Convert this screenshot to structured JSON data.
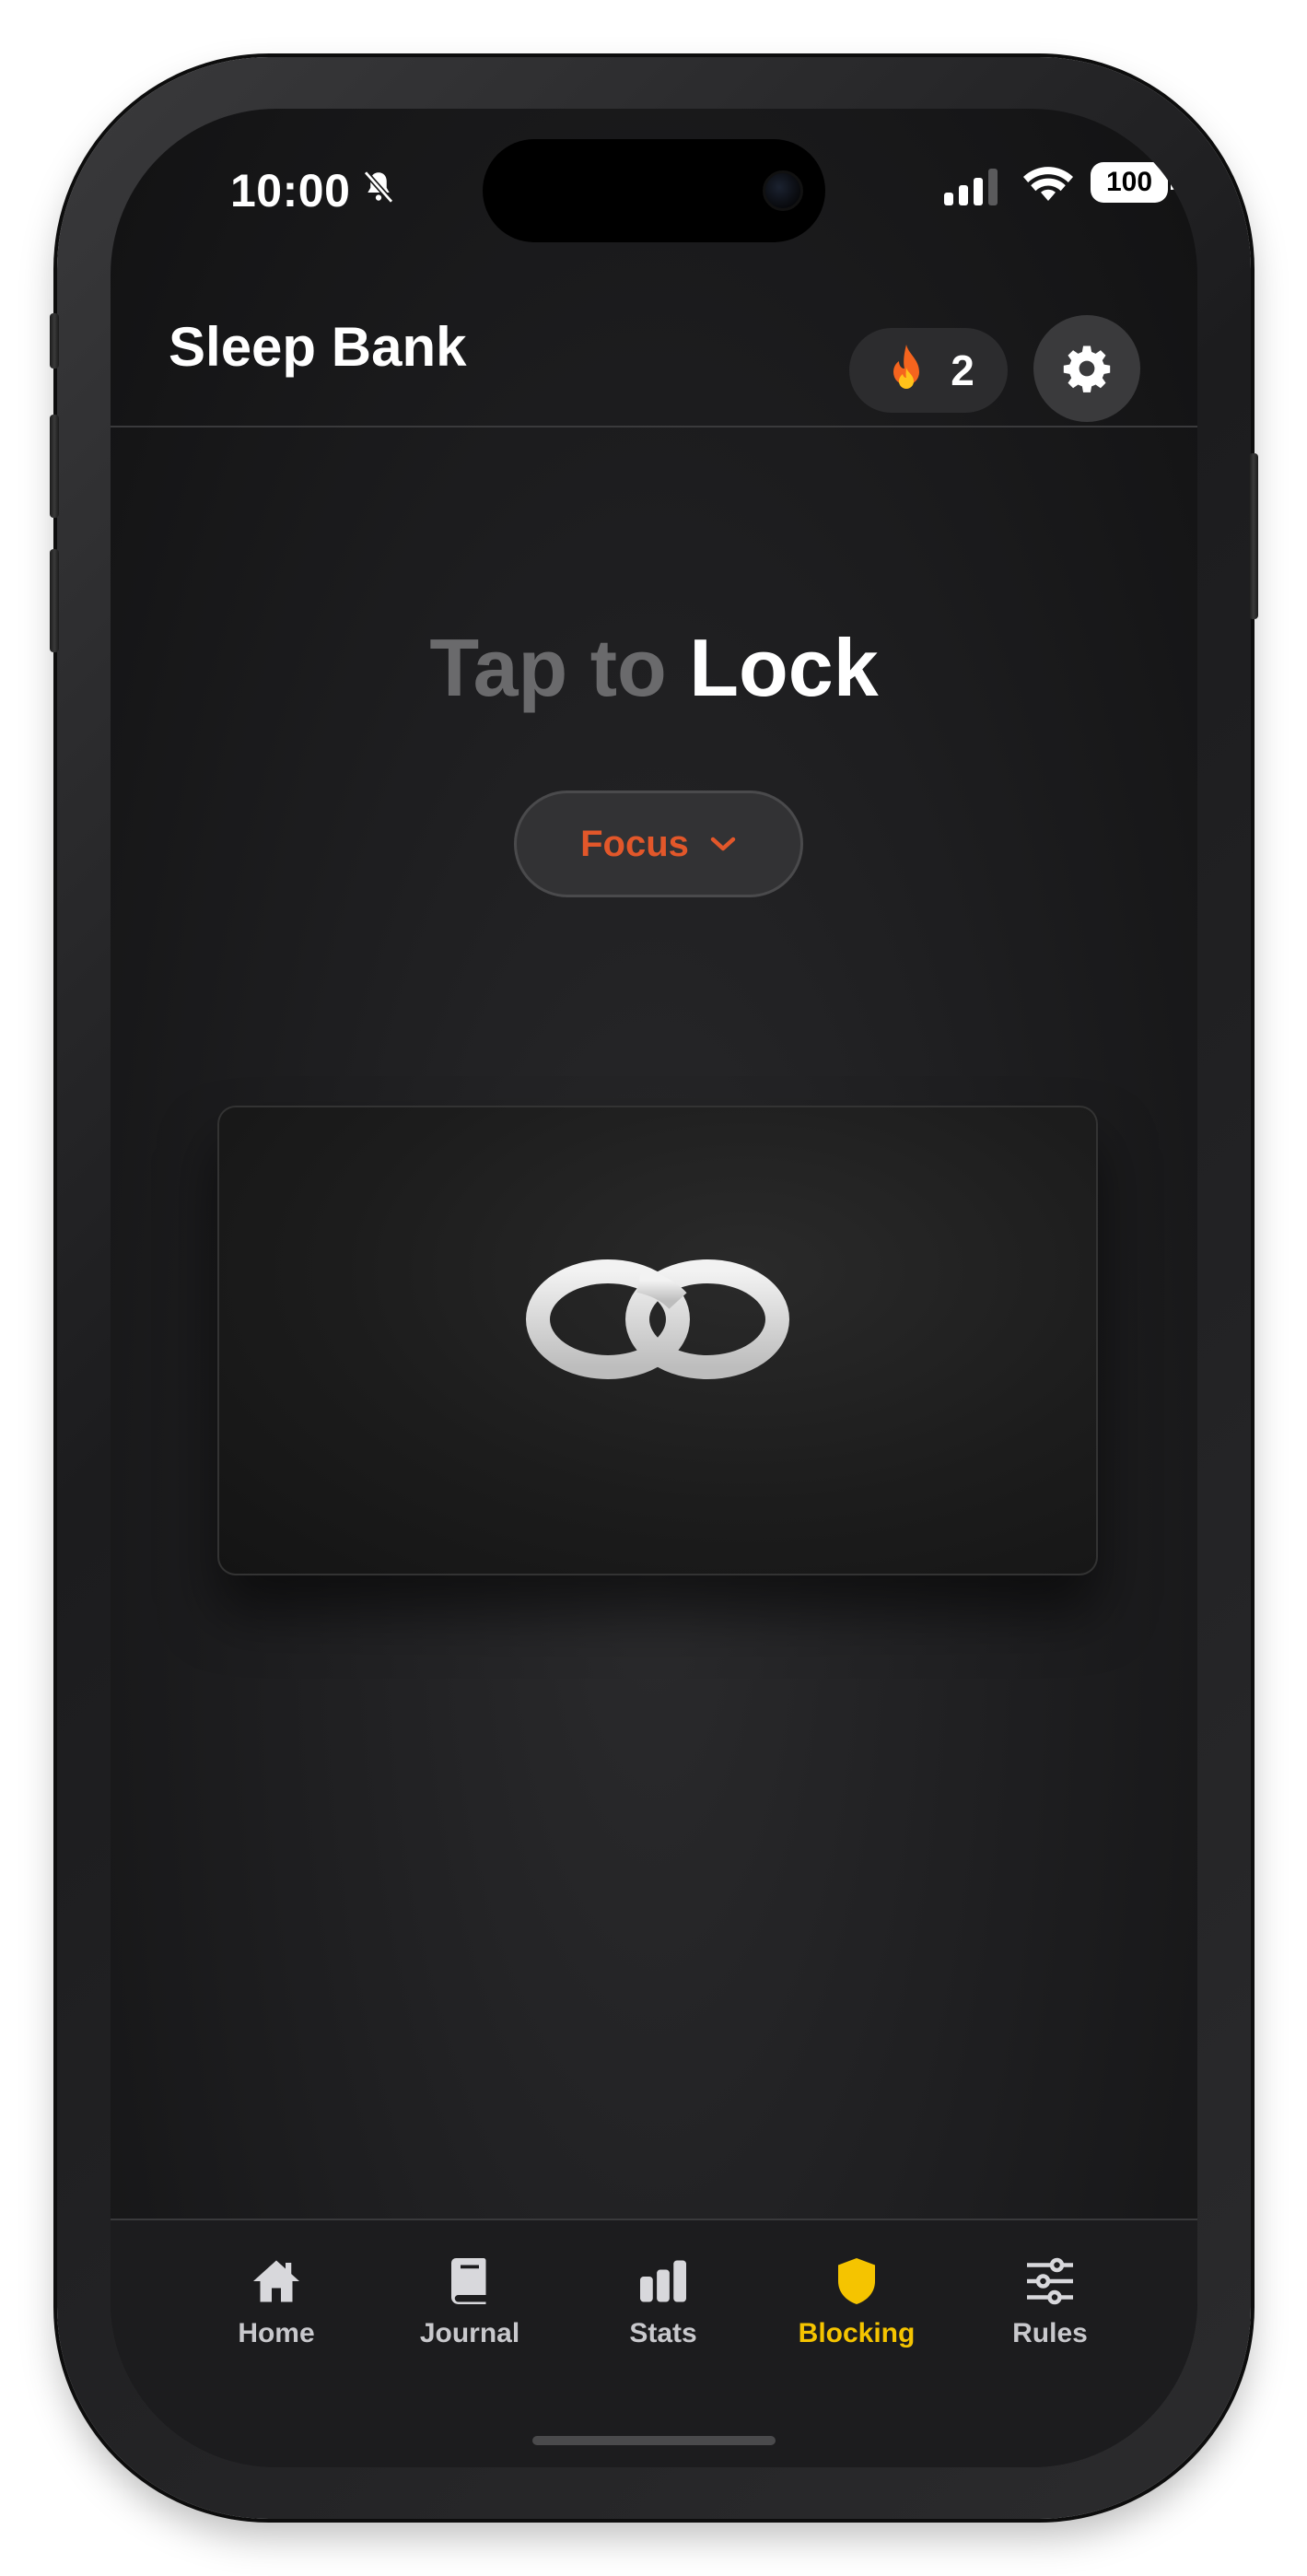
{
  "status_bar": {
    "time": "10:00",
    "battery": "100"
  },
  "header": {
    "title": "Sleep Bank",
    "streak_count": "2",
    "streak_icon": "fire-icon",
    "settings_icon": "gear-icon"
  },
  "main": {
    "headline_dim": "Tap to",
    "headline_bright": "Lock",
    "mode_selector": {
      "label": "Focus",
      "icon": "chevron-down-icon"
    },
    "card_icon": "linked-rings-icon"
  },
  "tabs": [
    {
      "label": "Home",
      "icon": "home-icon",
      "active": false
    },
    {
      "label": "Journal",
      "icon": "book-icon",
      "active": false
    },
    {
      "label": "Stats",
      "icon": "bar-chart-icon",
      "active": false
    },
    {
      "label": "Blocking",
      "icon": "shield-icon",
      "active": true
    },
    {
      "label": "Rules",
      "icon": "sliders-icon",
      "active": false
    }
  ],
  "colors": {
    "accent_active_tab": "#f5c400",
    "mode_text": "#e2572a",
    "background": "#1f1f21"
  }
}
